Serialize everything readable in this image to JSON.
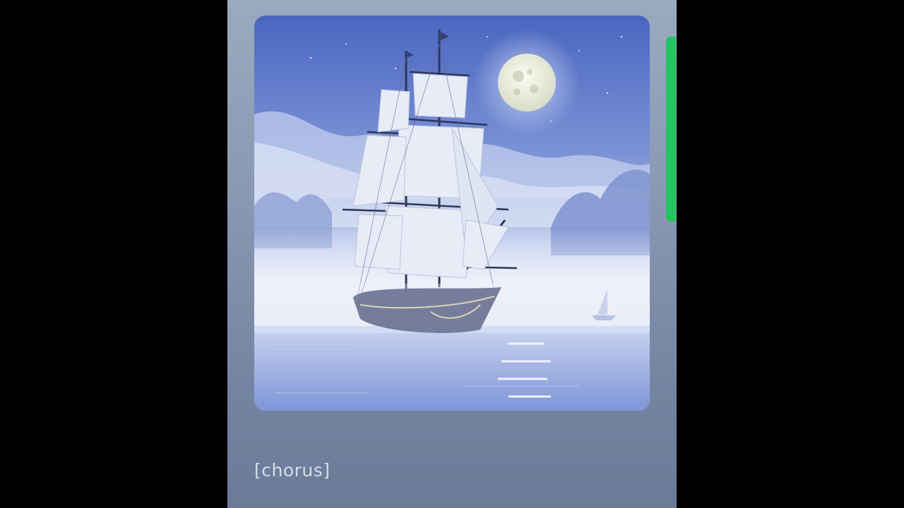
{
  "lyrics": {
    "current_line": "[chorus]"
  },
  "artwork": {
    "icon": "album-art-image"
  },
  "colors": {
    "background": "#000000",
    "panel_top": "#9aaac0",
    "panel_bottom": "#6a7b98",
    "accent": "#22c55e",
    "lyric_text": "#d7dde8"
  }
}
